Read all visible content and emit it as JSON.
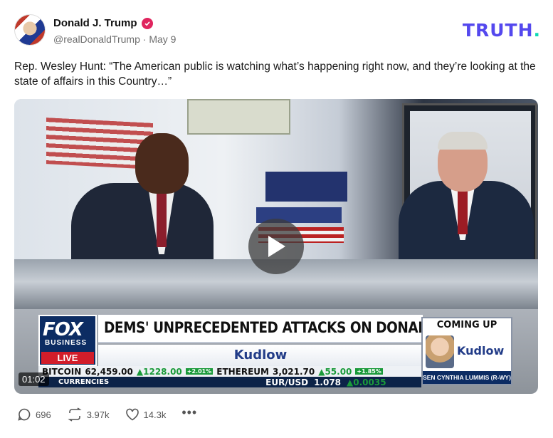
{
  "author": {
    "display_name": "Donald J. Trump",
    "handle": "@realDonaldTrump",
    "separator": "·",
    "date": "May 9",
    "verified": true
  },
  "brand": {
    "logo_text": "TRUTH",
    "logo_dot": ".",
    "logo_color": "#5448ee",
    "dot_color": "#10d9b4"
  },
  "post": {
    "text": "Rep. Wesley Hunt: “The American public is watching what’s happening right now, and they’re looking at the state of affairs in this Country…”"
  },
  "video": {
    "timestamp": "01:02",
    "lower_third": {
      "network": "FOX",
      "network_sub": "BUSINESS",
      "live": "LIVE",
      "headline": "DEMS' UNPRECEDENTED ATTACKS ON DONALD TRUMP",
      "show": "Kudlow"
    },
    "coming_up": {
      "title": "COMING UP",
      "show": "Kudlow",
      "guest": "SEN CYNTHIA LUMMIS (R-WY)"
    },
    "ticker": {
      "bitcoin_label": "BITCOIN",
      "bitcoin_value": "62,459.00",
      "bitcoin_change": "▲1228.00",
      "bitcoin_pct": "+2.01%",
      "eth_label": "ETHEREUM",
      "eth_value": "3,021.70",
      "eth_change": "▲55.00",
      "eth_pct": "+1.85%",
      "currencies_label": "CURRENCIES",
      "fx_label": "EUR/USD",
      "fx_value": "1.078",
      "fx_change": "▲0.0035"
    }
  },
  "actions": {
    "replies": "696",
    "retruths": "3.97k",
    "likes": "14.3k",
    "more": "•••"
  },
  "icons": {
    "reply": "reply-icon",
    "retruth": "retruth-icon",
    "like": "heart-icon",
    "play": "play-icon",
    "verified": "verified-badge-icon"
  }
}
